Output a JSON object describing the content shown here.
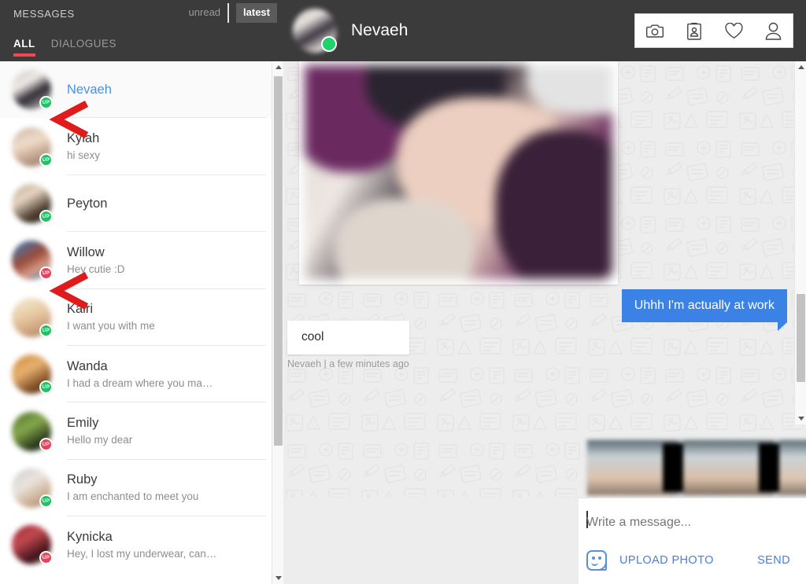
{
  "sidebar": {
    "title": "MESSAGES",
    "filters": [
      {
        "label": "unread",
        "active": false
      },
      {
        "label": "latest",
        "active": true
      }
    ],
    "tabs": [
      {
        "label": "ALL",
        "active": true
      },
      {
        "label": "DIALOGUES",
        "active": false
      }
    ],
    "conversations": [
      {
        "name": "Nevaeh",
        "message": "",
        "badge": "UP",
        "badge_color": "#21c263",
        "selected": true
      },
      {
        "name": "Kylah",
        "message": "hi sexy",
        "badge": "UP",
        "badge_color": "#21c263",
        "selected": false
      },
      {
        "name": "Peyton",
        "message": "",
        "badge": "UP",
        "badge_color": "#21c263",
        "selected": false
      },
      {
        "name": "Willow",
        "message": "Hey cutie :D",
        "badge": "UP",
        "badge_color": "#e8415a",
        "selected": false
      },
      {
        "name": "Kairi",
        "message": "I want you with me",
        "badge": "UP",
        "badge_color": "#21c263",
        "selected": false
      },
      {
        "name": "Wanda",
        "message": "I had a dream where you ma…",
        "badge": "UP",
        "badge_color": "#21c263",
        "selected": false
      },
      {
        "name": "Emily",
        "message": "Hello my dear",
        "badge": "UP",
        "badge_color": "#e8415a",
        "selected": false
      },
      {
        "name": "Ruby",
        "message": "I am enchanted to meet you",
        "badge": "UP",
        "badge_color": "#21c263",
        "selected": false
      },
      {
        "name": "Kynicka",
        "message": "Hey, I lost my underwear, can…",
        "badge": "UP",
        "badge_color": "#e8415a",
        "selected": false
      }
    ]
  },
  "chat": {
    "contact_name": "Nevaeh",
    "online": true,
    "actions": [
      {
        "icon": "camera-icon"
      },
      {
        "icon": "profile-card-icon"
      },
      {
        "icon": "heart-icon"
      },
      {
        "icon": "person-icon"
      }
    ],
    "messages": [
      {
        "type": "image",
        "from": "them"
      },
      {
        "type": "text",
        "from": "me",
        "text": "Uhhh I'm actually at work"
      },
      {
        "type": "text",
        "from": "them",
        "text": "cool",
        "meta": "Nevaeh | a few minutes ago"
      }
    ],
    "attachment_strip": {
      "type": "photo-strip"
    },
    "composer": {
      "placeholder": "Write a message...",
      "value": "",
      "upload_label": "UPLOAD PHOTO",
      "send_label": "SEND",
      "upload_icon": "smiley-photo-icon"
    }
  },
  "annotations": [
    {
      "type": "red-arrow",
      "target": "Nevaeh"
    },
    {
      "type": "red-arrow",
      "target": "Willow"
    }
  ],
  "colors": {
    "header_bg": "#3b3b3b",
    "accent_red": "#ef4a52",
    "link_blue": "#4a90e2",
    "bubble_blue": "#3b82e6",
    "online_green": "#21c263",
    "chat_bg": "#ededed"
  }
}
